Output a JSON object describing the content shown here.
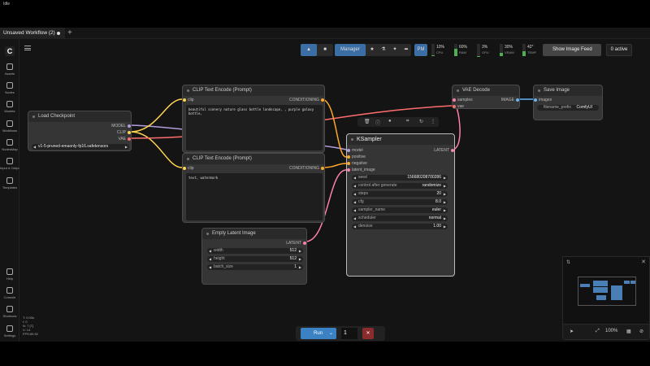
{
  "os": {
    "app_name": "Idle"
  },
  "tabs": {
    "active": "Unsaved Workflow (2)",
    "add": "+"
  },
  "sidebar": {
    "items": [
      {
        "label": "Assets"
      },
      {
        "label": "Nodes"
      },
      {
        "label": "Models"
      },
      {
        "label": "Workflows"
      },
      {
        "label": "NodesMap"
      },
      {
        "label": "Input & Outputs"
      },
      {
        "label": "Templates"
      },
      {
        "label": "Help"
      },
      {
        "label": "Console"
      },
      {
        "label": "Shortcuts"
      },
      {
        "label": "Settings"
      }
    ]
  },
  "toolbar": {
    "manager": "Manager",
    "pm": "PM",
    "meters": [
      {
        "pct": "10%",
        "name": "CPU",
        "value": 0.1
      },
      {
        "pct": "60%",
        "name": "RAM",
        "value": 0.6
      },
      {
        "pct": "3%",
        "name": "GPU",
        "value": 0.03
      },
      {
        "pct": "30%",
        "name": "VRAM",
        "value": 0.3
      },
      {
        "pct": "42°",
        "name": "TEMP",
        "value": 0.42
      }
    ],
    "show_feed": "Show Image Feed",
    "active": "0 active"
  },
  "nodes": {
    "load_checkpoint": {
      "title": "Load Checkpoint",
      "out_model": "MODEL",
      "out_clip": "CLIP",
      "out_vae": "VAE",
      "ckpt": "v1-5-pruned-emaonly-fp16.safetensors"
    },
    "clip_pos": {
      "title": "CLIP Text Encode (Prompt)",
      "in_clip": "clip",
      "out": "CONDITIONING",
      "text": "beautiful scenery nature glass bottle landscape, , purple galaxy bottle,"
    },
    "clip_neg": {
      "title": "CLIP Text Encode (Prompt)",
      "in_clip": "clip",
      "out": "CONDITIONING",
      "text": "text, watermark"
    },
    "vae_decode": {
      "title": "VAE Decode",
      "in_samples": "samples",
      "in_vae": "vae",
      "out": "IMAGE"
    },
    "save_image": {
      "title": "Save Image",
      "in_images": "images",
      "prefix_label": "filename_prefix",
      "prefix_value": "ComfyUI"
    },
    "ksampler": {
      "title": "KSampler",
      "in_model": "model",
      "in_pos": "positive",
      "in_neg": "negative",
      "in_latent": "latent_image",
      "out": "LATENT",
      "widgets": [
        {
          "label": "seed",
          "value": "156680208700286"
        },
        {
          "label": "control after generate",
          "value": "randomize"
        },
        {
          "label": "steps",
          "value": "20"
        },
        {
          "label": "cfg",
          "value": "8.0"
        },
        {
          "label": "sampler_name",
          "value": "euler"
        },
        {
          "label": "scheduler",
          "value": "normal"
        },
        {
          "label": "denoise",
          "value": "1.00"
        }
      ]
    },
    "empty_latent": {
      "title": "Empty Latent Image",
      "out": "LATENT",
      "widgets": [
        {
          "label": "width",
          "value": "512"
        },
        {
          "label": "height",
          "value": "512"
        },
        {
          "label": "batch_size",
          "value": "1"
        }
      ]
    }
  },
  "run": {
    "label": "Run",
    "count": "1"
  },
  "zoom": {
    "level": "100%"
  },
  "stats": {
    "l1": "T: 0.00s",
    "l2": "I: 0",
    "l3": "N: 7 [7]",
    "l4": "V: 14",
    "l5": "FPS:59.52"
  },
  "colors": {
    "accent": "#3b82c4",
    "model": "#b39ddb",
    "clip": "#ffd54f",
    "vae": "#ff6e6e",
    "conditioning": "#ffa726",
    "latent": "#ff80ab",
    "image": "#64b5f6"
  }
}
